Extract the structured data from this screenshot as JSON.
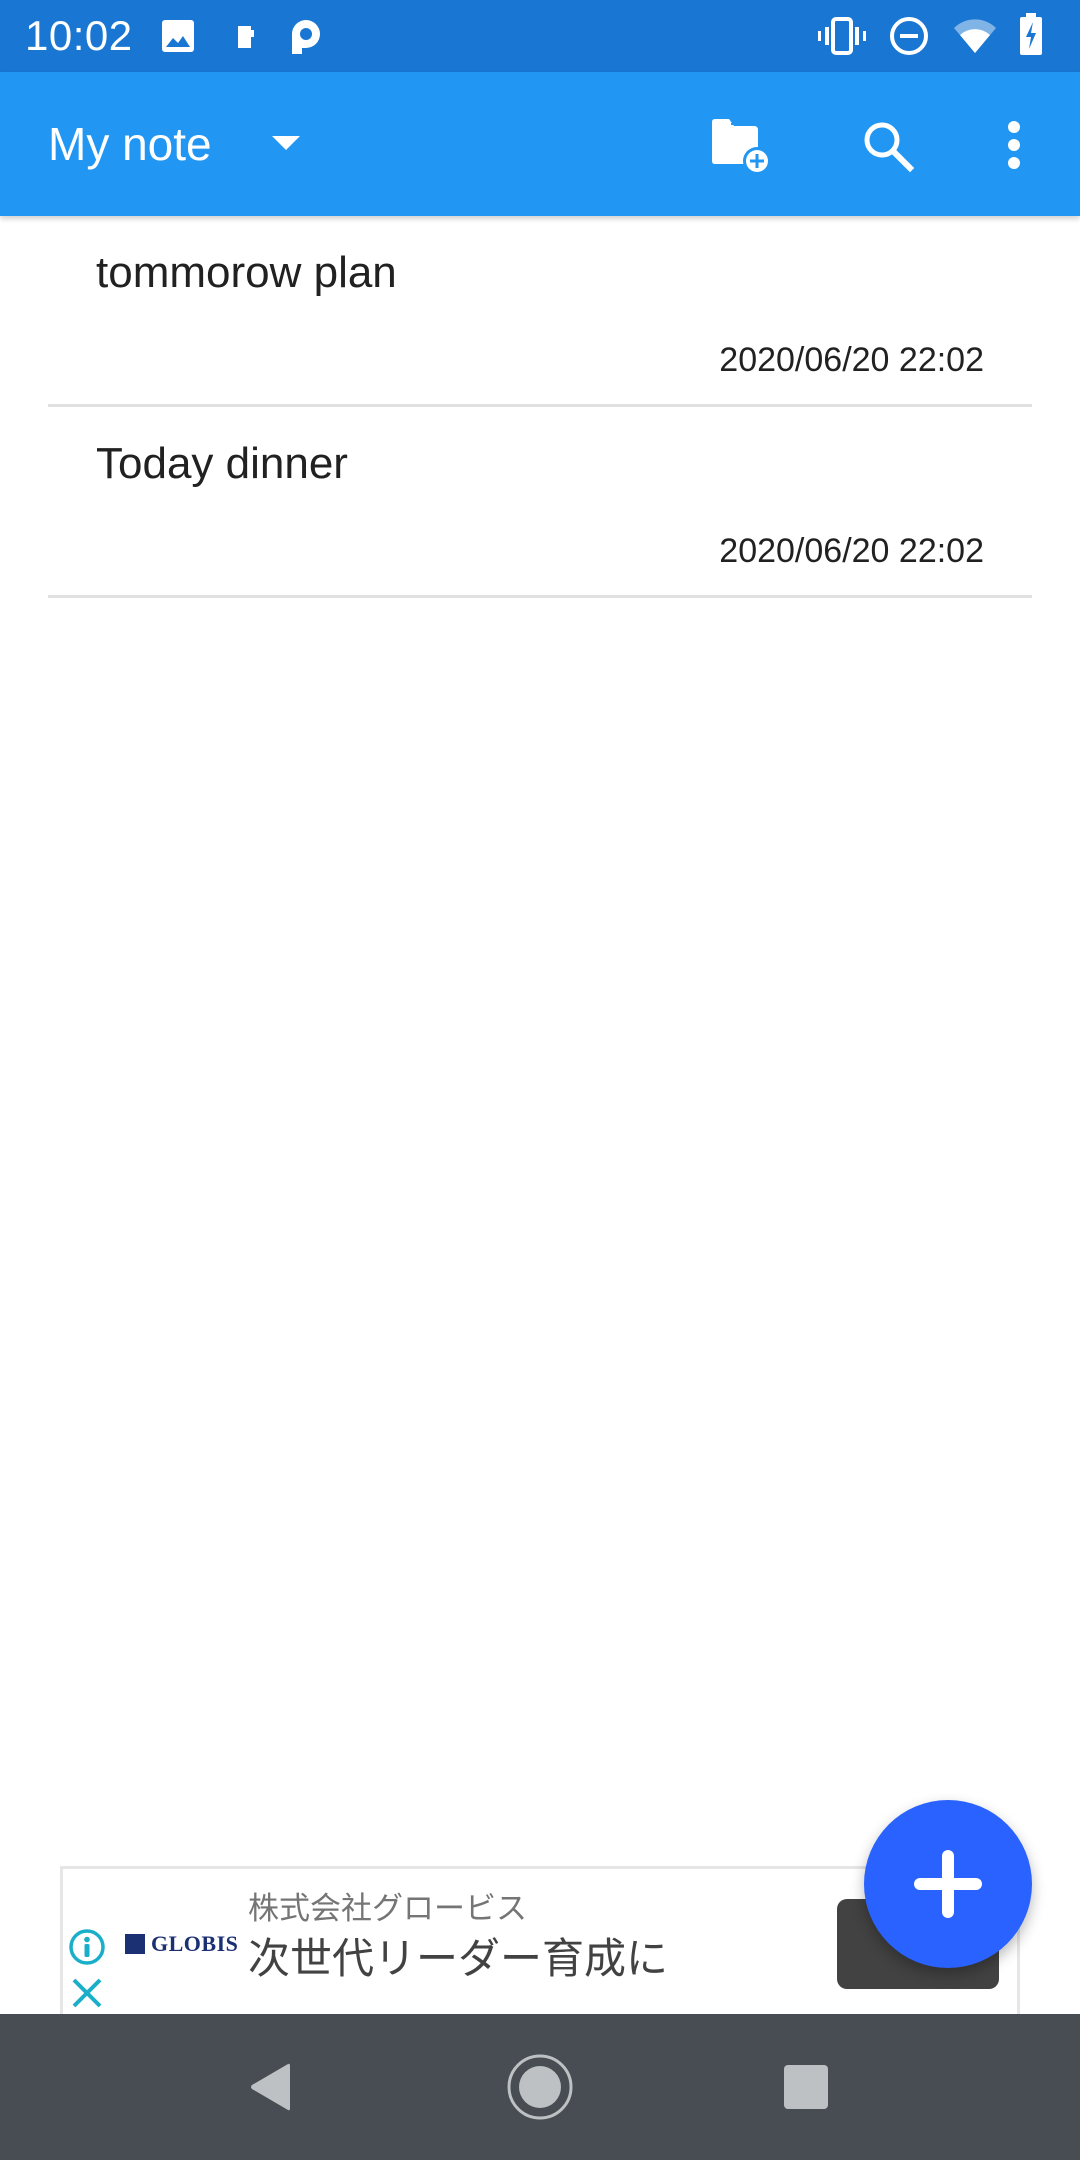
{
  "status_bar": {
    "time": "10:02",
    "left_icons": [
      "image-notification-icon",
      "sd-card-notification-icon",
      "p-app-notification-icon"
    ],
    "right_icons": [
      "vibrate-icon",
      "do-not-disturb-icon",
      "wifi-icon",
      "battery-charging-icon"
    ]
  },
  "toolbar": {
    "title": "My note",
    "actions": [
      {
        "name": "new-folder",
        "icon": "create-new-folder-icon"
      },
      {
        "name": "search",
        "icon": "search-icon"
      },
      {
        "name": "more-options",
        "icon": "more-vert-icon"
      }
    ]
  },
  "notes": [
    {
      "title": "tommorow plan",
      "date": "2020/06/20 22:02"
    },
    {
      "title": "Today dinner",
      "date": "2020/06/20 22:02"
    }
  ],
  "ad": {
    "brand": "GLOBIS",
    "company": "株式会社グロービス",
    "headline": "次世代リーダー育成に",
    "cta_label": ""
  },
  "fab": {
    "icon": "add-icon"
  },
  "nav_bar": {
    "buttons": [
      {
        "name": "back",
        "icon": "back-icon"
      },
      {
        "name": "home",
        "icon": "home-icon"
      },
      {
        "name": "recents",
        "icon": "recents-icon"
      }
    ]
  },
  "colors": {
    "status_bar": "#1976D2",
    "toolbar": "#2196F3",
    "fab": "#2962FF",
    "nav_bar": "#474D52",
    "ad_accent": "#1AAFC9",
    "divider": "#E0E0E0"
  }
}
